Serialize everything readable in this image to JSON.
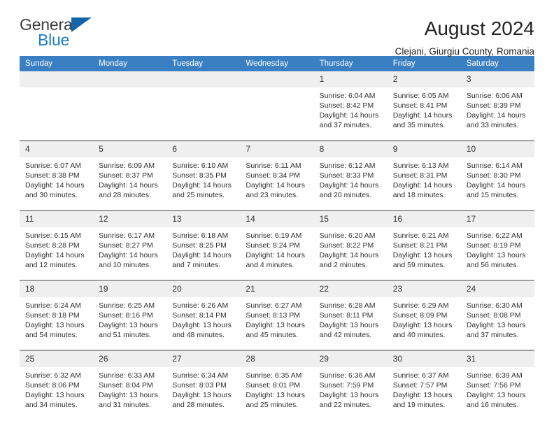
{
  "brand": {
    "name_part1": "General",
    "name_part2": "Blue",
    "triangle_color": "#1266a8",
    "blue_color": "#1f7ec4"
  },
  "header": {
    "title": "August 2024",
    "subtitle": "Clejani, Giurgiu County, Romania"
  },
  "theme": {
    "header_bar_color": "#3a7fc1",
    "daynum_band_color": "#efefef",
    "row_divider_color": "#9e9e9e",
    "text_color": "#303030"
  },
  "weekdays": [
    "Sunday",
    "Monday",
    "Tuesday",
    "Wednesday",
    "Thursday",
    "Friday",
    "Saturday"
  ],
  "labels": {
    "sunrise_prefix": "Sunrise: ",
    "sunset_prefix": "Sunset: ",
    "daylight_prefix": "Daylight: "
  },
  "weeks": [
    [
      {
        "day": "",
        "sunrise": "",
        "sunset": "",
        "daylight": "",
        "blank": true
      },
      {
        "day": "",
        "sunrise": "",
        "sunset": "",
        "daylight": "",
        "blank": true
      },
      {
        "day": "",
        "sunrise": "",
        "sunset": "",
        "daylight": "",
        "blank": true
      },
      {
        "day": "",
        "sunrise": "",
        "sunset": "",
        "daylight": "",
        "blank": true
      },
      {
        "day": "1",
        "sunrise": "Sunrise: 6:04 AM",
        "sunset": "Sunset: 8:42 PM",
        "daylight": "Daylight: 14 hours and 37 minutes.",
        "blank": false
      },
      {
        "day": "2",
        "sunrise": "Sunrise: 6:05 AM",
        "sunset": "Sunset: 8:41 PM",
        "daylight": "Daylight: 14 hours and 35 minutes.",
        "blank": false
      },
      {
        "day": "3",
        "sunrise": "Sunrise: 6:06 AM",
        "sunset": "Sunset: 8:39 PM",
        "daylight": "Daylight: 14 hours and 33 minutes.",
        "blank": false
      }
    ],
    [
      {
        "day": "4",
        "sunrise": "Sunrise: 6:07 AM",
        "sunset": "Sunset: 8:38 PM",
        "daylight": "Daylight: 14 hours and 30 minutes.",
        "blank": false
      },
      {
        "day": "5",
        "sunrise": "Sunrise: 6:09 AM",
        "sunset": "Sunset: 8:37 PM",
        "daylight": "Daylight: 14 hours and 28 minutes.",
        "blank": false
      },
      {
        "day": "6",
        "sunrise": "Sunrise: 6:10 AM",
        "sunset": "Sunset: 8:35 PM",
        "daylight": "Daylight: 14 hours and 25 minutes.",
        "blank": false
      },
      {
        "day": "7",
        "sunrise": "Sunrise: 6:11 AM",
        "sunset": "Sunset: 8:34 PM",
        "daylight": "Daylight: 14 hours and 23 minutes.",
        "blank": false
      },
      {
        "day": "8",
        "sunrise": "Sunrise: 6:12 AM",
        "sunset": "Sunset: 8:33 PM",
        "daylight": "Daylight: 14 hours and 20 minutes.",
        "blank": false
      },
      {
        "day": "9",
        "sunrise": "Sunrise: 6:13 AM",
        "sunset": "Sunset: 8:31 PM",
        "daylight": "Daylight: 14 hours and 18 minutes.",
        "blank": false
      },
      {
        "day": "10",
        "sunrise": "Sunrise: 6:14 AM",
        "sunset": "Sunset: 8:30 PM",
        "daylight": "Daylight: 14 hours and 15 minutes.",
        "blank": false
      }
    ],
    [
      {
        "day": "11",
        "sunrise": "Sunrise: 6:15 AM",
        "sunset": "Sunset: 8:28 PM",
        "daylight": "Daylight: 14 hours and 12 minutes.",
        "blank": false
      },
      {
        "day": "12",
        "sunrise": "Sunrise: 6:17 AM",
        "sunset": "Sunset: 8:27 PM",
        "daylight": "Daylight: 14 hours and 10 minutes.",
        "blank": false
      },
      {
        "day": "13",
        "sunrise": "Sunrise: 6:18 AM",
        "sunset": "Sunset: 8:25 PM",
        "daylight": "Daylight: 14 hours and 7 minutes.",
        "blank": false
      },
      {
        "day": "14",
        "sunrise": "Sunrise: 6:19 AM",
        "sunset": "Sunset: 8:24 PM",
        "daylight": "Daylight: 14 hours and 4 minutes.",
        "blank": false
      },
      {
        "day": "15",
        "sunrise": "Sunrise: 6:20 AM",
        "sunset": "Sunset: 8:22 PM",
        "daylight": "Daylight: 14 hours and 2 minutes.",
        "blank": false
      },
      {
        "day": "16",
        "sunrise": "Sunrise: 6:21 AM",
        "sunset": "Sunset: 8:21 PM",
        "daylight": "Daylight: 13 hours and 59 minutes.",
        "blank": false
      },
      {
        "day": "17",
        "sunrise": "Sunrise: 6:22 AM",
        "sunset": "Sunset: 8:19 PM",
        "daylight": "Daylight: 13 hours and 56 minutes.",
        "blank": false
      }
    ],
    [
      {
        "day": "18",
        "sunrise": "Sunrise: 6:24 AM",
        "sunset": "Sunset: 8:18 PM",
        "daylight": "Daylight: 13 hours and 54 minutes.",
        "blank": false
      },
      {
        "day": "19",
        "sunrise": "Sunrise: 6:25 AM",
        "sunset": "Sunset: 8:16 PM",
        "daylight": "Daylight: 13 hours and 51 minutes.",
        "blank": false
      },
      {
        "day": "20",
        "sunrise": "Sunrise: 6:26 AM",
        "sunset": "Sunset: 8:14 PM",
        "daylight": "Daylight: 13 hours and 48 minutes.",
        "blank": false
      },
      {
        "day": "21",
        "sunrise": "Sunrise: 6:27 AM",
        "sunset": "Sunset: 8:13 PM",
        "daylight": "Daylight: 13 hours and 45 minutes.",
        "blank": false
      },
      {
        "day": "22",
        "sunrise": "Sunrise: 6:28 AM",
        "sunset": "Sunset: 8:11 PM",
        "daylight": "Daylight: 13 hours and 42 minutes.",
        "blank": false
      },
      {
        "day": "23",
        "sunrise": "Sunrise: 6:29 AM",
        "sunset": "Sunset: 8:09 PM",
        "daylight": "Daylight: 13 hours and 40 minutes.",
        "blank": false
      },
      {
        "day": "24",
        "sunrise": "Sunrise: 6:30 AM",
        "sunset": "Sunset: 8:08 PM",
        "daylight": "Daylight: 13 hours and 37 minutes.",
        "blank": false
      }
    ],
    [
      {
        "day": "25",
        "sunrise": "Sunrise: 6:32 AM",
        "sunset": "Sunset: 8:06 PM",
        "daylight": "Daylight: 13 hours and 34 minutes.",
        "blank": false
      },
      {
        "day": "26",
        "sunrise": "Sunrise: 6:33 AM",
        "sunset": "Sunset: 8:04 PM",
        "daylight": "Daylight: 13 hours and 31 minutes.",
        "blank": false
      },
      {
        "day": "27",
        "sunrise": "Sunrise: 6:34 AM",
        "sunset": "Sunset: 8:03 PM",
        "daylight": "Daylight: 13 hours and 28 minutes.",
        "blank": false
      },
      {
        "day": "28",
        "sunrise": "Sunrise: 6:35 AM",
        "sunset": "Sunset: 8:01 PM",
        "daylight": "Daylight: 13 hours and 25 minutes.",
        "blank": false
      },
      {
        "day": "29",
        "sunrise": "Sunrise: 6:36 AM",
        "sunset": "Sunset: 7:59 PM",
        "daylight": "Daylight: 13 hours and 22 minutes.",
        "blank": false
      },
      {
        "day": "30",
        "sunrise": "Sunrise: 6:37 AM",
        "sunset": "Sunset: 7:57 PM",
        "daylight": "Daylight: 13 hours and 19 minutes.",
        "blank": false
      },
      {
        "day": "31",
        "sunrise": "Sunrise: 6:39 AM",
        "sunset": "Sunset: 7:56 PM",
        "daylight": "Daylight: 13 hours and 16 minutes.",
        "blank": false
      }
    ]
  ]
}
